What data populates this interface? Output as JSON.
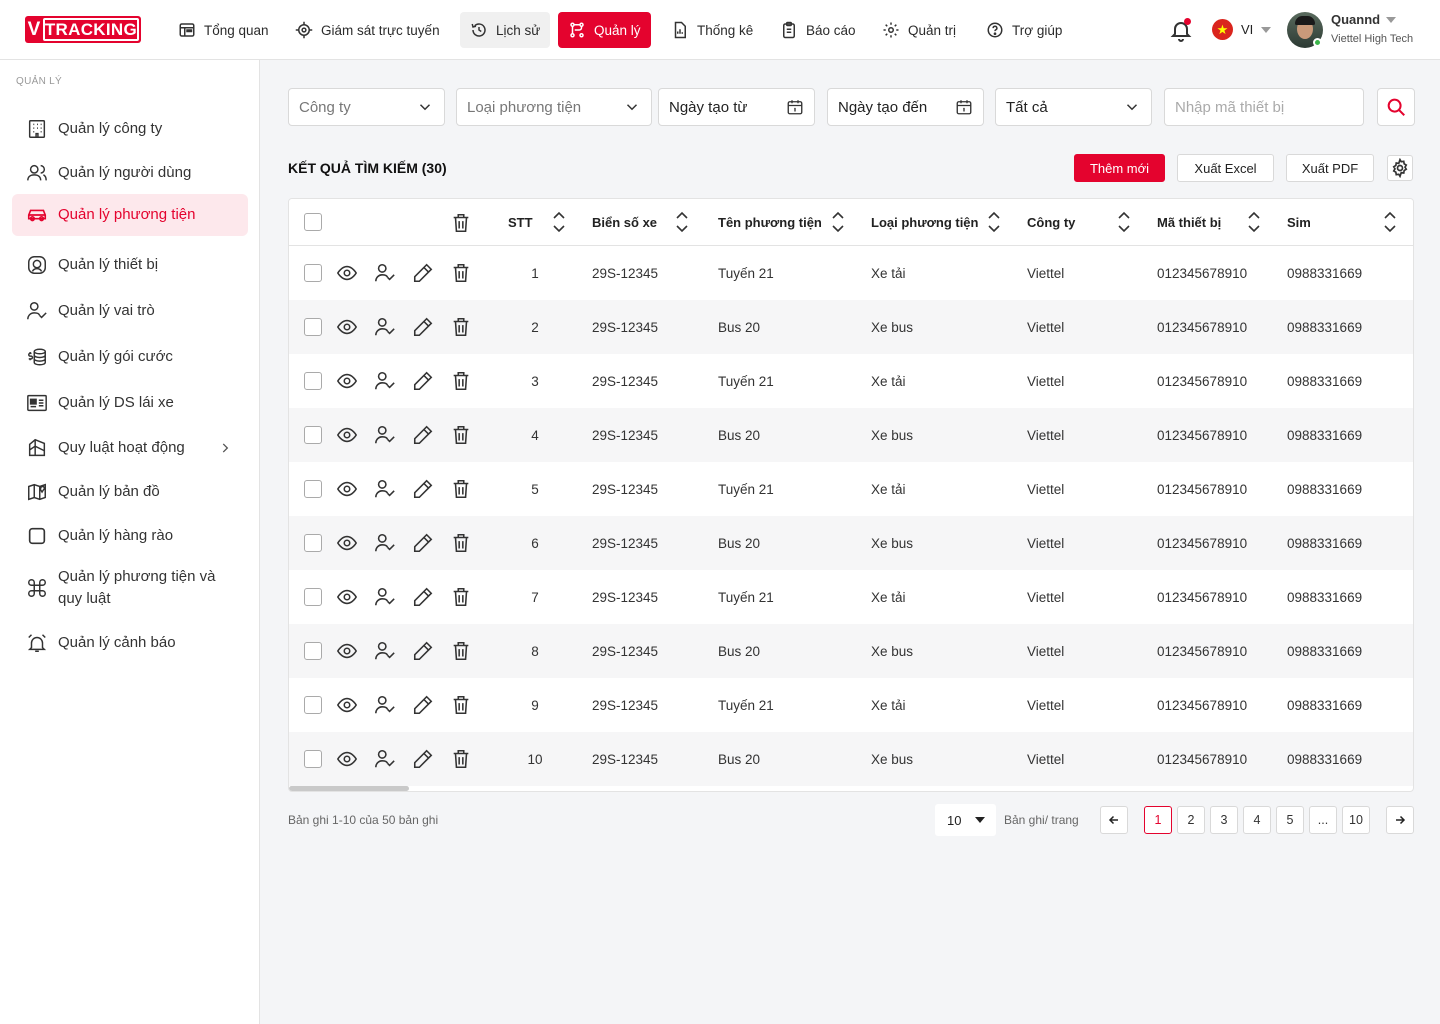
{
  "app": {
    "logo_v": "V",
    "logo_text": "TRACKING"
  },
  "topnav": [
    {
      "label": "Tổng quan",
      "icon": "dashboard-icon"
    },
    {
      "label": "Giám sát trực tuyến",
      "icon": "crosshair-icon"
    },
    {
      "label": "Lịch sử",
      "icon": "history-icon"
    },
    {
      "label": "Quản lý",
      "icon": "management-icon",
      "active": true
    },
    {
      "label": "Thống kê",
      "icon": "stats-file-icon"
    },
    {
      "label": "Báo cáo",
      "icon": "clipboard-icon"
    },
    {
      "label": "Quản trị",
      "icon": "gear-icon"
    },
    {
      "label": "Trợ giúp",
      "icon": "help-circle-icon"
    }
  ],
  "header": {
    "lang": "VI",
    "user_name": "Quannd",
    "user_company": "Viettel High Tech"
  },
  "sidebar": {
    "section": "QUẢN LÝ",
    "items": [
      {
        "label": "Quản lý công ty",
        "icon": "building-icon"
      },
      {
        "label": "Quản lý người dùng",
        "icon": "users-icon"
      },
      {
        "label": "Quản lý phương tiện",
        "icon": "car-icon",
        "active": true
      },
      {
        "label": "Quản lý thiết bị",
        "icon": "device-icon"
      },
      {
        "label": "Quản lý vai trò",
        "icon": "user-check-icon"
      },
      {
        "label": "Quản lý gói cước",
        "icon": "coins-icon"
      },
      {
        "label": "Quản lý DS lái xe",
        "icon": "id-card-icon"
      },
      {
        "label": "Quy luật hoạt động",
        "icon": "rules-icon",
        "has_submenu": true
      },
      {
        "label": "Quản lý bản đồ",
        "icon": "map-icon"
      },
      {
        "label": "Quản lý hàng rào",
        "icon": "square-icon"
      },
      {
        "label": "Quản lý phương tiện và",
        "label2": "quy luật",
        "icon": "command-icon"
      },
      {
        "label": "Quản lý cảnh báo",
        "icon": "alarm-icon"
      }
    ]
  },
  "filters": {
    "company": "Công ty",
    "vehicle_type": "Loại phương tiện",
    "date_from": "Ngày tạo từ",
    "date_to": "Ngày tạo đến",
    "status": "Tất cả",
    "device_placeholder": "Nhập mã thiết bị"
  },
  "results": {
    "title": "KẾT QUẢ TÌM KIẾM (30)",
    "add_label": "Thêm mới",
    "excel_label": "Xuất Excel",
    "pdf_label": "Xuất PDF"
  },
  "table": {
    "columns": [
      "STT",
      "Biển số xe",
      "Tên phương tiện",
      "Loại phương tiện",
      "Công ty",
      "Mã thiết bị",
      "Sim"
    ],
    "rows": [
      [
        "1",
        "29S-12345",
        "Tuyến 21",
        "Xe tải",
        "Viettel",
        "012345678910",
        "0988331669"
      ],
      [
        "2",
        "29S-12345",
        "Bus 20",
        "Xe bus",
        "Viettel",
        "012345678910",
        "0988331669"
      ],
      [
        "3",
        "29S-12345",
        "Tuyến 21",
        "Xe tải",
        "Viettel",
        "012345678910",
        "0988331669"
      ],
      [
        "4",
        "29S-12345",
        "Bus 20",
        "Xe bus",
        "Viettel",
        "012345678910",
        "0988331669"
      ],
      [
        "5",
        "29S-12345",
        "Tuyến 21",
        "Xe tải",
        "Viettel",
        "012345678910",
        "0988331669"
      ],
      [
        "6",
        "29S-12345",
        "Bus 20",
        "Xe bus",
        "Viettel",
        "012345678910",
        "0988331669"
      ],
      [
        "7",
        "29S-12345",
        "Tuyến 21",
        "Xe tải",
        "Viettel",
        "012345678910",
        "0988331669"
      ],
      [
        "8",
        "29S-12345",
        "Bus 20",
        "Xe bus",
        "Viettel",
        "012345678910",
        "0988331669"
      ],
      [
        "9",
        "29S-12345",
        "Tuyến 21",
        "Xe tải",
        "Viettel",
        "012345678910",
        "0988331669"
      ],
      [
        "10",
        "29S-12345",
        "Bus 20",
        "Xe bus",
        "Viettel",
        "012345678910",
        "0988331669"
      ]
    ]
  },
  "pagination": {
    "summary": "Bản ghi 1-10 của 50 bản ghi",
    "page_size": "10",
    "page_size_label": "Bản ghi/ trang",
    "pages": [
      "1",
      "2",
      "3",
      "4",
      "5",
      "...",
      "10"
    ],
    "current": "1"
  },
  "colors": {
    "accent": "#e4032e",
    "active_bg": "#fde8ec"
  }
}
